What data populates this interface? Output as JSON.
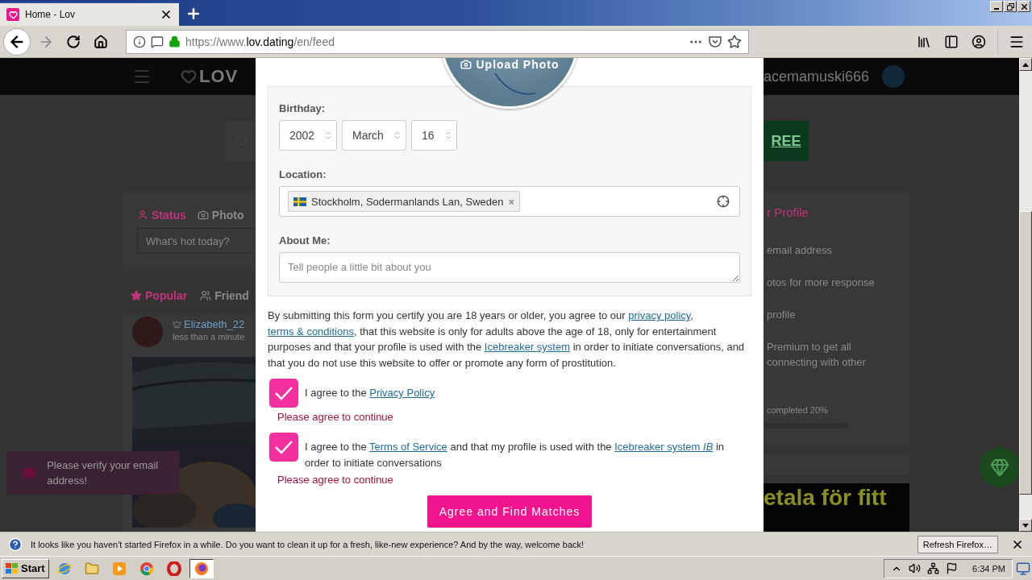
{
  "browser": {
    "tab_title": "Home - Lov",
    "url": "https://www.**lov.dating**/en/feed"
  },
  "page": {
    "logo": "LOV",
    "username": "acemamuski666",
    "post_box": {
      "tabs": [
        {
          "label": "Status",
          "selected": true
        },
        {
          "label": "Photo",
          "selected": false
        }
      ],
      "placeholder": "What's hot today?"
    },
    "feed_tabs": [
      {
        "label": "Popular",
        "selected": true
      },
      {
        "label": "Friend",
        "selected": false
      }
    ],
    "post": {
      "author": "Elizabeth_22",
      "time": "less than a minute"
    },
    "toast": "Please verify your email address!",
    "promo_button": "REE",
    "profile_card": {
      "title": "r Profile",
      "tasks": [
        "email address",
        "otos for more response",
        "profile",
        "Premium to get all connecting with other"
      ],
      "progress_label": "completed 20%"
    },
    "ad_text": "etala för fitt"
  },
  "modal": {
    "upload_label": "Upload Photo",
    "birthday": {
      "label": "Birthday:",
      "year": "2002",
      "month": "March",
      "day": "16"
    },
    "location": {
      "label": "Location:",
      "tag": "Stockholm, Sodermanlands Lan, Sweden",
      "remove": "×"
    },
    "about": {
      "label": "About Me:",
      "placeholder": "Tell people a little bit about you"
    },
    "consent": [
      {
        "kind": "text",
        "text": "By submitting this form you certify you are 18 years or older, you agree to our "
      },
      {
        "kind": "link",
        "text": "privacy policy"
      },
      {
        "kind": "text",
        "text": ", "
      },
      {
        "kind": "link",
        "text": "terms & conditions"
      },
      {
        "kind": "text",
        "text": ", that this website is only for adults above the age of 18, only for entertainment purposes and that your profile is used with the "
      },
      {
        "kind": "link",
        "text": "Icebreaker system"
      },
      {
        "kind": "text",
        "text": " in order to initiate conversations, and that you do not use this website to offer or promote any form of prostitution."
      }
    ],
    "agreements": [
      {
        "checked": true,
        "label": [
          {
            "kind": "text",
            "text": "I agree to the "
          },
          {
            "kind": "link",
            "text": "Privacy Policy"
          }
        ],
        "error": "Please agree to continue"
      },
      {
        "checked": true,
        "label": [
          {
            "kind": "text",
            "text": "I agree to the "
          },
          {
            "kind": "link",
            "text": "Terms of Service"
          },
          {
            "kind": "text",
            "text": " and that my profile is used with the "
          },
          {
            "kind": "link",
            "text": "Icebreaker system *IB*"
          },
          {
            "kind": "text",
            "text": " in order to initiate conversations"
          }
        ],
        "error": "Please agree to continue"
      }
    ],
    "submit": "Agree and Find Matches"
  },
  "notification": {
    "message": "It looks like you haven't started Firefox in a while. Do you want to clean it up for a fresh, like-new experience? And by the way, welcome back!",
    "button": "Refresh Firefox…"
  },
  "taskbar": {
    "start": "Start",
    "apps": [
      {
        "kind": "ie",
        "selected": false
      },
      {
        "kind": "folder",
        "selected": false
      },
      {
        "kind": "media",
        "selected": false
      },
      {
        "kind": "chrome",
        "selected": false
      },
      {
        "kind": "opera",
        "selected": false
      },
      {
        "kind": "firefox",
        "selected": true
      }
    ],
    "clock": "6:34 PM"
  }
}
